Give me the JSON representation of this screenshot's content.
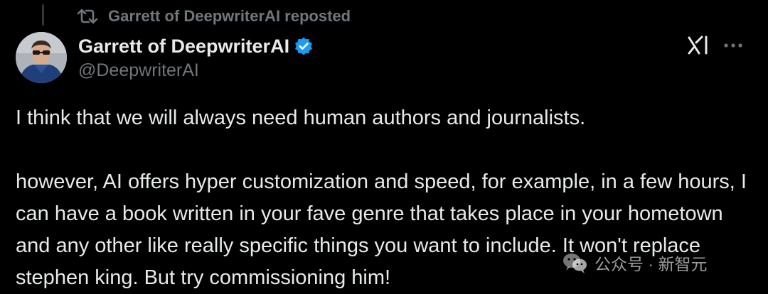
{
  "repost": {
    "icon": "repost-icon",
    "text": "Garrett of DeepwriterAI reposted"
  },
  "author": {
    "name": "Garrett of DeepwriterAI",
    "handle": "@DeepwriterAI",
    "verified": true,
    "verified_color": "#1d9bf0"
  },
  "actions": {
    "grok_icon": "grok-icon",
    "more_icon": "more-icon"
  },
  "tweet": {
    "paragraph_1": "I think that we will always need human authors and journalists.",
    "paragraph_2": "however, AI offers hyper customization and speed, for example, in a few hours, I can have a book written in your fave genre that takes place in your hometown and any other like really specific things you want to include. It won't replace stephen king. But try commissioning him!"
  },
  "watermark": {
    "text": "公众号 · 新智元",
    "icon": "wechat-icon"
  },
  "colors": {
    "background": "#000000",
    "text_primary": "#e7e9ea",
    "text_secondary": "#71767b",
    "accent": "#1d9bf0"
  }
}
